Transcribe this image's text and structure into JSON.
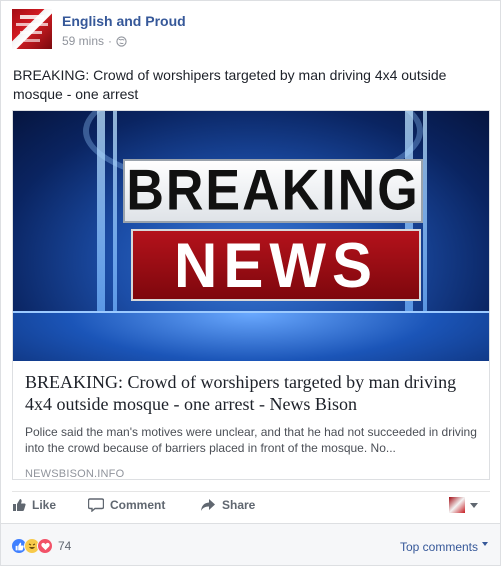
{
  "post": {
    "page_name": "English and Proud",
    "time": "59 mins",
    "separator": "·",
    "privacy_icon": "globe-icon",
    "text": "BREAKING: Crowd of worshipers targeted by man driving 4x4 outside mosque - one arrest"
  },
  "link_preview": {
    "image_text_top": "BREAKING",
    "image_text_bottom": "NEWS",
    "title": "BREAKING: Crowd of worshipers targeted by man driving 4x4 outside mosque - one arrest - News Bison",
    "description": "Police said the man's motives were unclear, and that he had not succeeded in driving into the crowd because of barriers placed in front of the mosque. No...",
    "domain": "NEWSBISON.INFO"
  },
  "actions": {
    "like_label": "Like",
    "comment_label": "Comment",
    "share_label": "Share"
  },
  "reactions": {
    "types": [
      "like",
      "haha",
      "love"
    ],
    "count": "74",
    "sort_label": "Top comments"
  },
  "colors": {
    "link_blue": "#365899",
    "like_blue": "#4080ff",
    "love_red": "#f25268",
    "haha_yellow": "#f7c94a",
    "breaking_red": "#b4121b"
  }
}
